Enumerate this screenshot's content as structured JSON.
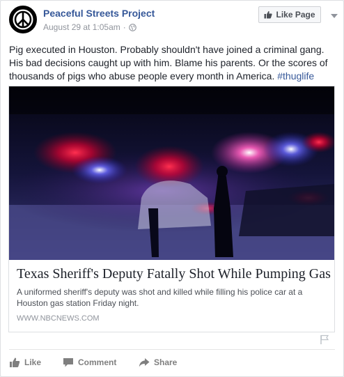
{
  "post": {
    "page_name": "Peaceful Streets Project",
    "timestamp": "August 29 at 1:05am",
    "separator": "·",
    "like_page_label": "Like Page",
    "text": "Pig executed in Houston. Probably shouldn't have joined a criminal gang. His bad decisions caught up with him. Blame his parents. Or the scores of thousands of pigs who abuse people every month in America. ",
    "hashtag": "#thuglife"
  },
  "link_preview": {
    "title": "Texas Sheriff's Deputy Fatally Shot While Pumping Gas",
    "description": "A uniformed sheriff's deputy was shot and killed while filling his police car at a Houston gas station Friday night.",
    "source": "WWW.NBCNEWS.COM"
  },
  "actions": {
    "like_label": "Like",
    "comment_label": "Comment",
    "share_label": "Share"
  },
  "colors": {
    "link_blue": "#365899",
    "meta_gray": "#90949c",
    "action_gray": "#7f7f7f"
  },
  "icons": [
    "peace-logo-avatar",
    "globe-icon",
    "thumbs-up-icon",
    "chevron-down-icon",
    "flag-icon",
    "comment-icon",
    "share-arrow-icon"
  ]
}
